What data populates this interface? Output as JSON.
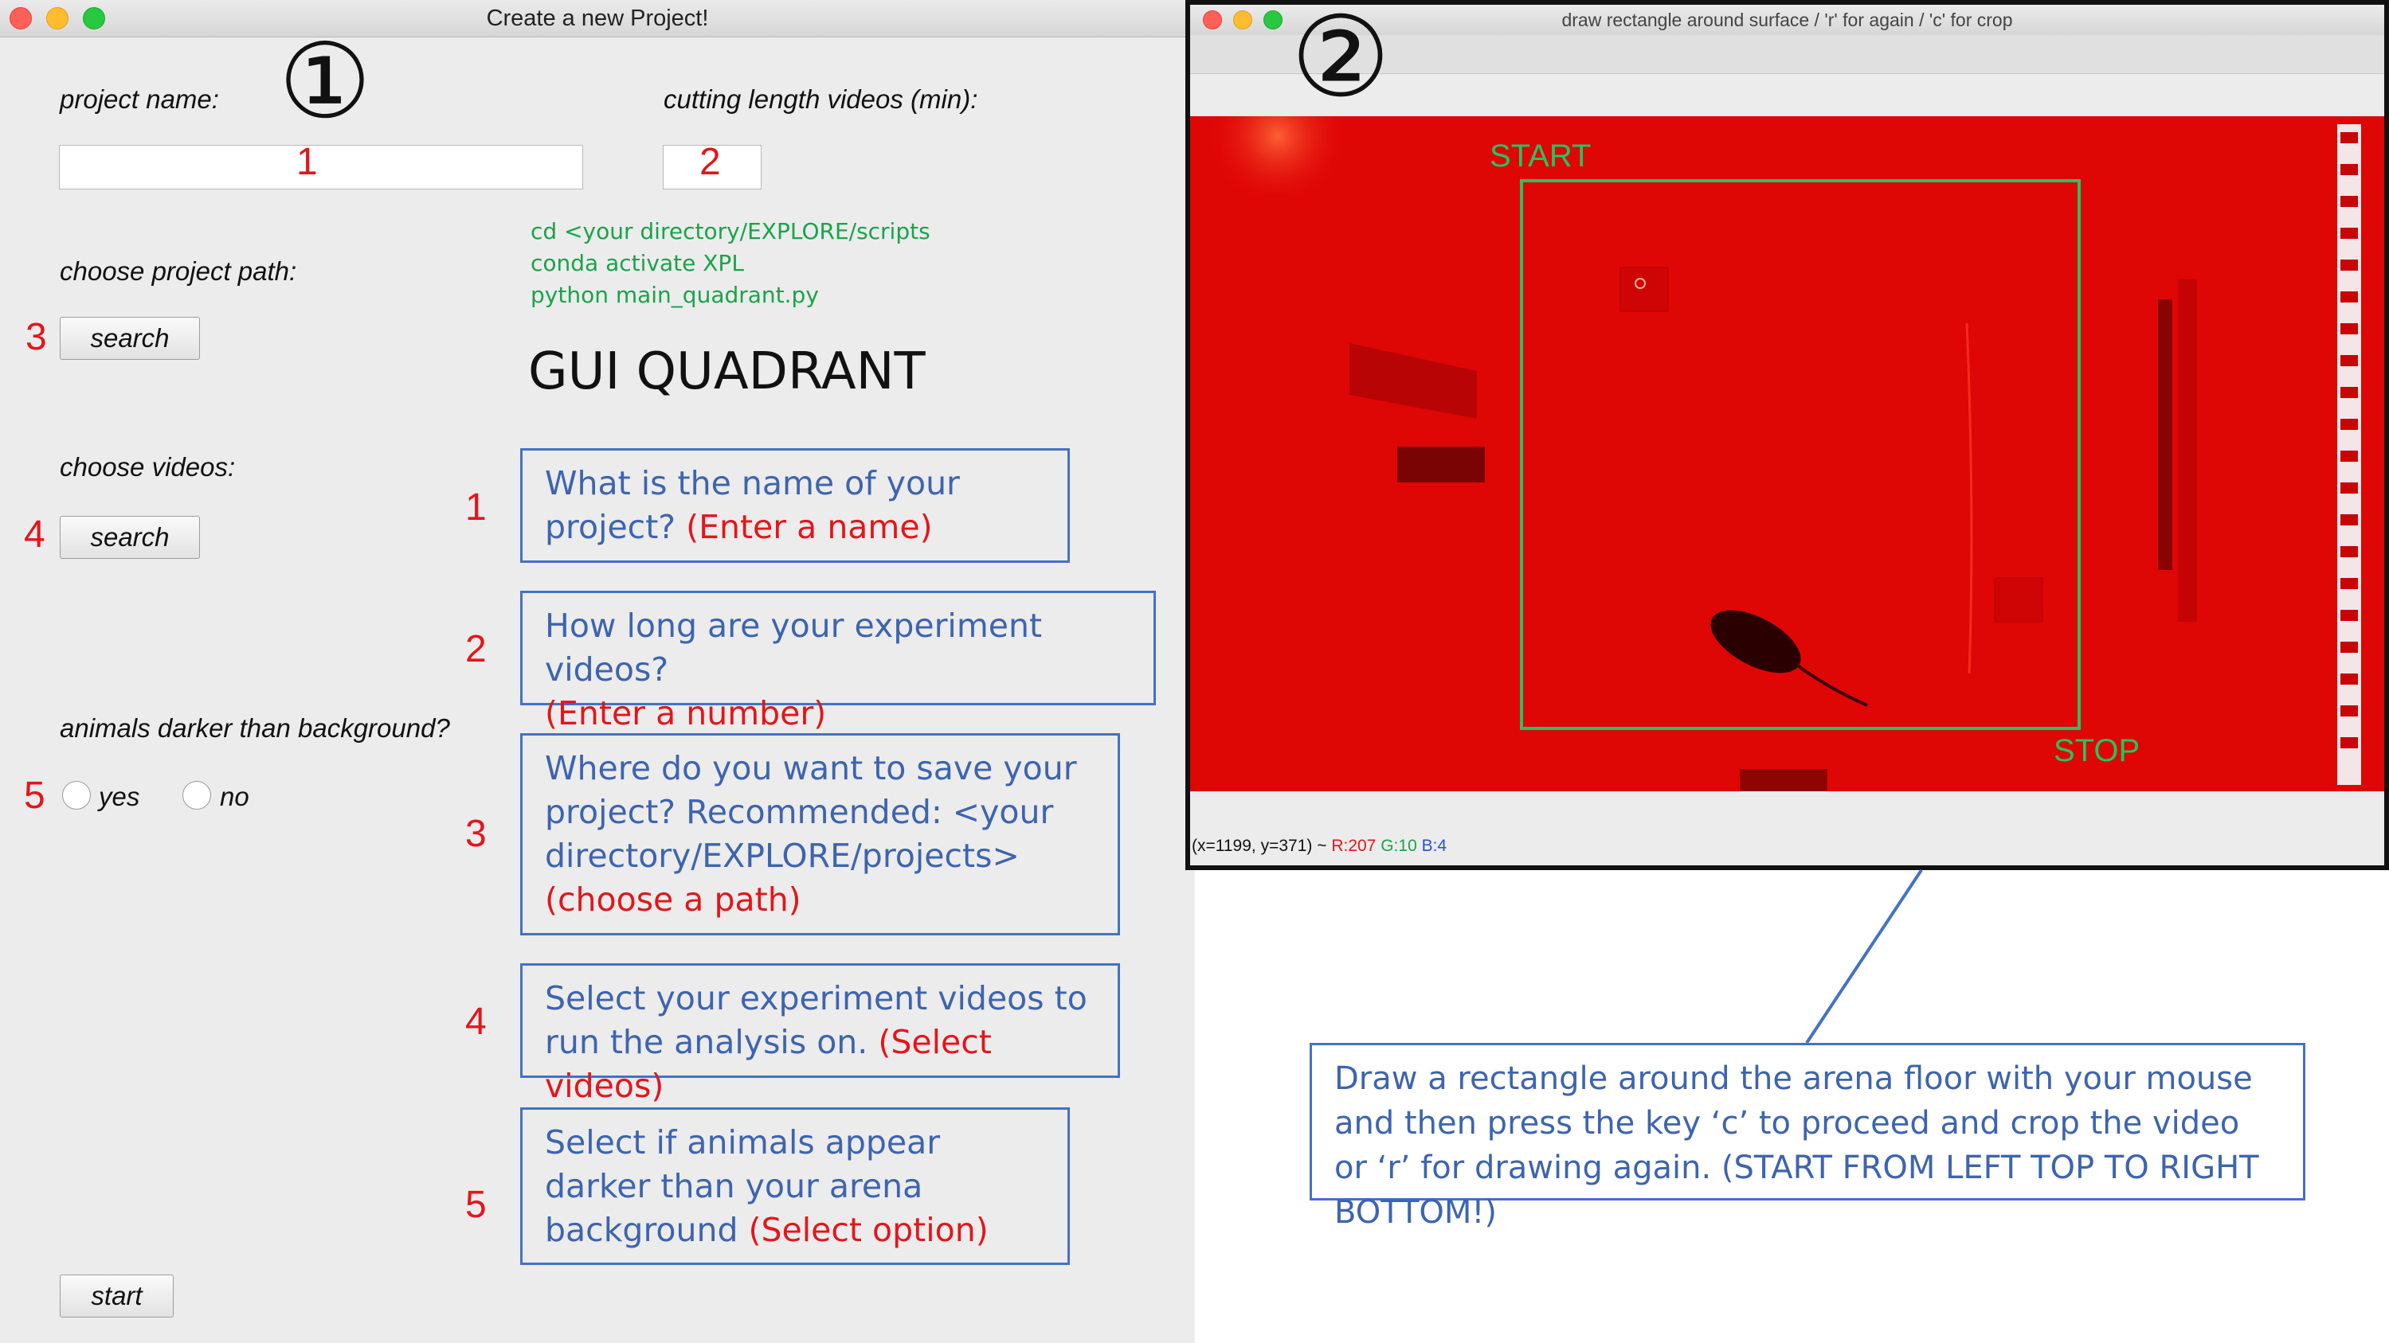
{
  "window1": {
    "title": "Create a new Project!",
    "project_name_label": "project name:",
    "cutting_length_label": "cutting length videos (min):",
    "project_path_label": "choose project path:",
    "videos_label": "choose videos:",
    "animals_label": "animals darker than background?",
    "search_label": "search",
    "yes_label": "yes",
    "no_label": "no",
    "start_label": "start",
    "marker": "①"
  },
  "code_lines": [
    "cd <your directory/EXPLORE/scripts",
    "conda activate XPL",
    "python main_quadrant.py"
  ],
  "gui_title": "GUI QUADRANT",
  "step_numbers": [
    "1",
    "2",
    "3",
    "4",
    "5"
  ],
  "notes": [
    {
      "text": "What is the name of your project? ",
      "action": "(Enter a name)"
    },
    {
      "text": "How long are your experiment videos? ",
      "action": "(Enter a number)"
    },
    {
      "text": "Where do you want to save your project? Recommended: <your directory/EXPLORE/projects> ",
      "action": "(choose a path)"
    },
    {
      "text": "Select your experiment videos to run the analysis on. ",
      "action": "(Select videos)"
    },
    {
      "text": "Select if animals appear darker than your arena background ",
      "action": "(Select option)"
    }
  ],
  "window2": {
    "title": "draw rectangle around surface / 'r' for again / 'c' for crop",
    "marker": "②",
    "start_label": "START",
    "stop_label": "STOP",
    "status_coords": "(x=1199, y=371) ~",
    "status_r": "R:207",
    "status_g": "G:10",
    "status_b": "B:4",
    "status_colors": {
      "r": "#e3161b",
      "g": "#1aa34a",
      "b": "#2255cc"
    }
  },
  "instruction_note": "Draw a rectangle around the arena floor with your mouse and then press the key ‘c’ to proceed and crop the video or ‘r’ for drawing again. (START FROM LEFT TOP TO RIGHT BOTTOM!)"
}
